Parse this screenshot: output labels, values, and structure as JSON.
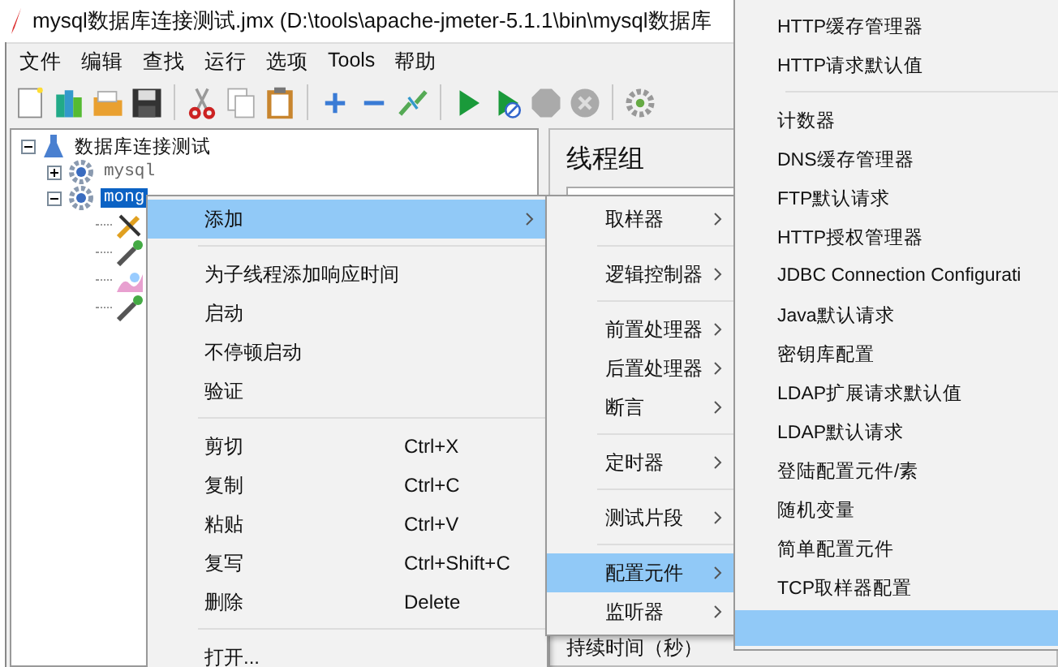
{
  "window": {
    "title": "mysql数据库连接测试.jmx (D:\\tools\\apache-jmeter-5.1.1\\bin\\mysql数据库"
  },
  "menu_bar": [
    "文件",
    "编辑",
    "查找",
    "运行",
    "选项",
    "Tools",
    "帮助"
  ],
  "tree": {
    "label": "数据库连接测试",
    "expanded": true,
    "selected": false,
    "children": [
      {
        "label": "mysql",
        "expanded": false,
        "selected": false
      },
      {
        "label": "mong",
        "expanded": true,
        "selected": true,
        "children": [
          {
            "kind": "wrench"
          },
          {
            "kind": "dropper"
          },
          {
            "kind": "chart"
          },
          {
            "kind": "dropper"
          }
        ]
      }
    ]
  },
  "right_panel": {
    "title": "线程组",
    "field_label": "持续时间（秒）"
  },
  "context_menu": {
    "groups": [
      [
        {
          "label": "添加",
          "submenu": true,
          "selected": true
        }
      ],
      [
        {
          "label": "为子线程添加响应时间",
          "submenu": false,
          "selected": false
        },
        {
          "label": "启动",
          "submenu": false,
          "selected": false
        },
        {
          "label": "不停顿启动",
          "submenu": false,
          "selected": false
        },
        {
          "label": "验证",
          "submenu": false,
          "selected": false
        }
      ],
      [
        {
          "label": "剪切",
          "shortcut": "Ctrl+X",
          "submenu": false,
          "selected": false
        },
        {
          "label": "复制",
          "shortcut": "Ctrl+C",
          "submenu": false,
          "selected": false
        },
        {
          "label": "粘贴",
          "shortcut": "Ctrl+V",
          "submenu": false,
          "selected": false
        },
        {
          "label": "复写",
          "shortcut": "Ctrl+Shift+C",
          "submenu": false,
          "selected": false
        },
        {
          "label": "删除",
          "shortcut": "Delete",
          "submenu": false,
          "selected": false
        }
      ],
      [
        {
          "label": "打开...",
          "submenu": false,
          "selected": false
        }
      ]
    ]
  },
  "add_submenu": {
    "groups": [
      [
        {
          "label": "取样器",
          "selected": false
        }
      ],
      [
        {
          "label": "逻辑控制器",
          "selected": false
        }
      ],
      [
        {
          "label": "前置处理器",
          "selected": false
        },
        {
          "label": "后置处理器",
          "selected": false
        },
        {
          "label": "断言",
          "selected": false
        }
      ],
      [
        {
          "label": "定时器",
          "selected": false
        }
      ],
      [
        {
          "label": "测试片段",
          "selected": false
        }
      ],
      [
        {
          "label": "配置元件",
          "selected": true
        },
        {
          "label": "监听器",
          "selected": false
        }
      ]
    ]
  },
  "config_menu": {
    "highlight_bar": true,
    "groups": [
      [
        "HTTP缓存管理器",
        "HTTP请求默认值"
      ],
      [
        "计数器",
        "DNS缓存管理器",
        "FTP默认请求",
        "HTTP授权管理器",
        "JDBC Connection Configurati",
        "Java默认请求",
        "密钥库配置",
        "LDAP扩展请求默认值",
        "LDAP默认请求",
        "登陆配置元件/素",
        "随机变量",
        "简单配置元件",
        "TCP取样器配置"
      ]
    ]
  }
}
